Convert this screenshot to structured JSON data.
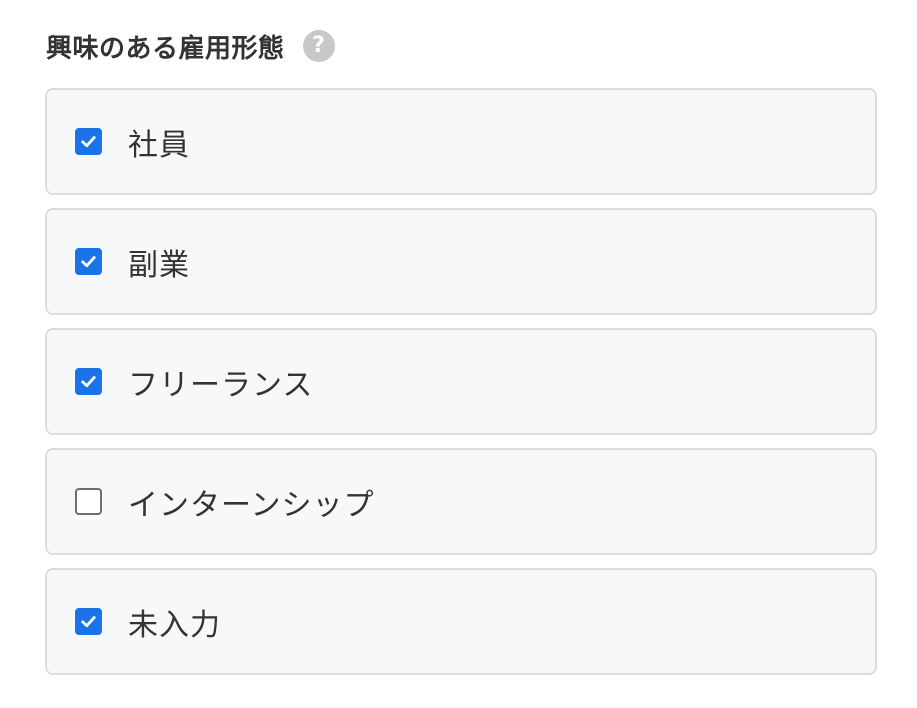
{
  "section": {
    "title": "興味のある雇用形態",
    "help_icon": "question-circle-icon",
    "help_glyph": "?"
  },
  "options": [
    {
      "label": "社員",
      "checked": true
    },
    {
      "label": "副業",
      "checked": true
    },
    {
      "label": "フリーランス",
      "checked": true
    },
    {
      "label": "インターンシップ",
      "checked": false
    },
    {
      "label": "未入力",
      "checked": true
    }
  ],
  "colors": {
    "checkbox_checked": "#1a73e8",
    "checkbox_unchecked_border": "#6e6e6e",
    "option_background": "#f7f8fa",
    "option_border": "#dcdcdc",
    "help_icon": "#c8c8c8"
  }
}
